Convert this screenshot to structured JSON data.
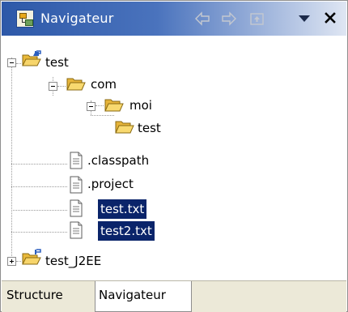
{
  "view": {
    "title": "Navigateur",
    "toolbar": {
      "back_icon": "arrow-left-icon",
      "forward_icon": "arrow-right-icon",
      "up_icon": "go-up-icon",
      "menu_icon": "view-menu-triangle-icon",
      "close_icon": "close-icon"
    }
  },
  "tree": {
    "nodes": [
      {
        "label": "test",
        "icon": "project-folder-icon",
        "expander": "minus",
        "selected": false
      },
      {
        "label": "com",
        "icon": "folder-open-icon",
        "expander": "minus",
        "selected": false
      },
      {
        "label": "moi",
        "icon": "folder-open-icon",
        "expander": "minus",
        "selected": false
      },
      {
        "label": "test",
        "icon": "folder-open-icon",
        "expander": "none",
        "selected": false
      },
      {
        "label": ".classpath",
        "icon": "file-icon",
        "expander": "none",
        "selected": false
      },
      {
        "label": ".project",
        "icon": "file-icon",
        "expander": "none",
        "selected": false
      },
      {
        "label": "test.txt",
        "icon": "file-icon",
        "expander": "none",
        "selected": true
      },
      {
        "label": "test2.txt",
        "icon": "file-icon",
        "expander": "none",
        "selected": true
      },
      {
        "label": "test_J2EE",
        "icon": "project-folder-icon",
        "expander": "plus",
        "selected": false
      }
    ]
  },
  "tabs": [
    {
      "label": "Structure",
      "active": false
    },
    {
      "label": "Navigateur",
      "active": true
    }
  ],
  "colors": {
    "selection_bg": "#0a246a",
    "titlebar_start": "#2d58a8",
    "titlebar_end": "#dfe6f3",
    "tabbar_bg": "#ece9d8"
  }
}
